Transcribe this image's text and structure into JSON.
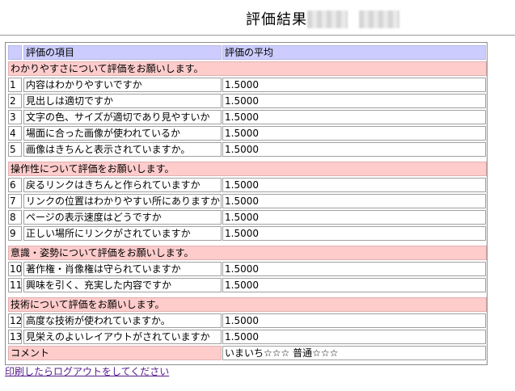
{
  "page": {
    "title": "評価結果",
    "logout_link": "印刷したらログアウトをしてください"
  },
  "table": {
    "header": {
      "item": "評価の項目",
      "average": "評価の平均"
    },
    "sections": [
      {
        "heading": "わかりやすさについて評価をお願いします。",
        "rows": [
          {
            "no": "1",
            "item": "内容はわかりやすいですか",
            "avg": "1.5000"
          },
          {
            "no": "2",
            "item": "見出しは適切ですか",
            "avg": "1.5000"
          },
          {
            "no": "3",
            "item": "文字の色、サイズが適切であり見やすいか",
            "avg": "1.5000"
          },
          {
            "no": "4",
            "item": "場面に合った画像が使われているか",
            "avg": "1.5000"
          },
          {
            "no": "5",
            "item": "画像はきちんと表示されていますか。",
            "avg": "1.5000"
          }
        ]
      },
      {
        "heading": "操作性について評価をお願いします。",
        "rows": [
          {
            "no": "6",
            "item": "戻るリンクはきちんと作られていますか",
            "avg": "1.5000"
          },
          {
            "no": "7",
            "item": "リンクの位置はわかりやすい所にありますか",
            "avg": "1.5000"
          },
          {
            "no": "8",
            "item": "ページの表示速度はどうですか",
            "avg": "1.5000"
          },
          {
            "no": "9",
            "item": "正しい場所にリンクがされていますか",
            "avg": "1.5000"
          }
        ]
      },
      {
        "heading": "意識・姿勢について評価をお願いします。",
        "rows": [
          {
            "no": "10",
            "item": "著作権・肖像権は守られていますか",
            "avg": "1.5000"
          },
          {
            "no": "11",
            "item": "興味を引く、充実した内容ですか",
            "avg": "1.5000"
          }
        ]
      },
      {
        "heading": "技術について評価をお願いします。",
        "rows": [
          {
            "no": "12",
            "item": "高度な技術が使われていますか。",
            "avg": "1.5000"
          },
          {
            "no": "13",
            "item": "見栄えのよいレイアウトがされていますか",
            "avg": "1.5000"
          }
        ]
      }
    ],
    "comment": {
      "label": "コメント",
      "value": "いまいち☆☆☆ 普通☆☆☆"
    }
  }
}
